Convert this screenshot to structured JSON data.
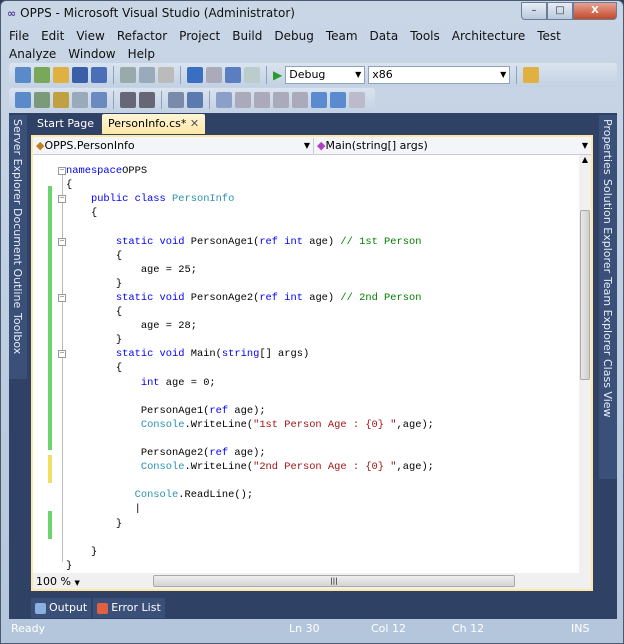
{
  "window": {
    "title": "OPPS - Microsoft Visual Studio (Administrator)",
    "minimize": "–",
    "maximize": "□",
    "close": "X"
  },
  "menu": [
    "File",
    "Edit",
    "View",
    "Refactor",
    "Project",
    "Build",
    "Debug",
    "Team",
    "Data",
    "Tools",
    "Architecture",
    "Test",
    "Analyze",
    "Window",
    "Help"
  ],
  "toolbar": {
    "config": "Debug",
    "platform": "x86"
  },
  "left_panels": [
    "Server Explorer",
    "Document Outline",
    "Toolbox"
  ],
  "right_panels": [
    "Properties",
    "Solution Explorer",
    "Team Explorer",
    "Class View"
  ],
  "tabs": [
    {
      "label": "Start Page"
    },
    {
      "label": "PersonInfo.cs*",
      "close": "✕"
    }
  ],
  "nav": {
    "type": "OPPS.PersonInfo",
    "member": "Main(string[] args)"
  },
  "code": [
    [
      [
        "kw",
        "namespace"
      ],
      [
        "",
        "OPPS"
      ]
    ],
    [
      [
        "",
        "{"
      ]
    ],
    [
      [
        "",
        "    "
      ],
      [
        "kw",
        "public class "
      ],
      [
        "ty",
        "PersonInfo"
      ]
    ],
    [
      [
        "",
        "    {"
      ]
    ],
    [],
    [
      [
        "",
        "        "
      ],
      [
        "kw",
        "static void "
      ],
      [
        "",
        "PersonAge1("
      ],
      [
        "kw",
        "ref int "
      ],
      [
        "",
        "age) "
      ],
      [
        "cm",
        "// 1st Person"
      ]
    ],
    [
      [
        "",
        "        {"
      ]
    ],
    [
      [
        "",
        "            age = 25;"
      ]
    ],
    [
      [
        "",
        "        }"
      ]
    ],
    [
      [
        "",
        "        "
      ],
      [
        "kw",
        "static void "
      ],
      [
        "",
        "PersonAge2("
      ],
      [
        "kw",
        "ref int "
      ],
      [
        "",
        "age) "
      ],
      [
        "cm",
        "// 2nd Person"
      ]
    ],
    [
      [
        "",
        "        {"
      ]
    ],
    [
      [
        "",
        "            age = 28;"
      ]
    ],
    [
      [
        "",
        "        }"
      ]
    ],
    [
      [
        "",
        "        "
      ],
      [
        "kw",
        "static void "
      ],
      [
        "",
        "Main("
      ],
      [
        "kw",
        "string"
      ],
      [
        "",
        "[] args)"
      ]
    ],
    [
      [
        "",
        "        {"
      ]
    ],
    [
      [
        "",
        "            "
      ],
      [
        "kw",
        "int "
      ],
      [
        "",
        "age = 0;"
      ]
    ],
    [],
    [
      [
        "",
        "            PersonAge1("
      ],
      [
        "kw",
        "ref "
      ],
      [
        "",
        "age);"
      ]
    ],
    [
      [
        "",
        "            "
      ],
      [
        "ty",
        "Console"
      ],
      [
        "",
        ".WriteLine("
      ],
      [
        "st",
        "\"1st Person Age : {0} \""
      ],
      [
        "",
        ",age);"
      ]
    ],
    [],
    [
      [
        "",
        "            PersonAge2("
      ],
      [
        "kw",
        "ref "
      ],
      [
        "",
        "age);"
      ]
    ],
    [
      [
        "",
        "            "
      ],
      [
        "ty",
        "Console"
      ],
      [
        "",
        ".WriteLine("
      ],
      [
        "st",
        "\"2nd Person Age : {0} \""
      ],
      [
        "",
        ",age);"
      ]
    ],
    [],
    [
      [
        "",
        "           "
      ],
      [
        "ty",
        "Console"
      ],
      [
        "",
        ".ReadLine();"
      ]
    ],
    [
      [
        "",
        "           |"
      ]
    ],
    [
      [
        "",
        "        }"
      ]
    ],
    [],
    [
      [
        "",
        "    }"
      ]
    ],
    [
      [
        "",
        "}"
      ]
    ]
  ],
  "zoom": "100 %",
  "bottom_tabs": [
    "Output",
    "Error List"
  ],
  "status": {
    "ready": "Ready",
    "ln": "Ln 30",
    "col": "Col 12",
    "ch": "Ch 12",
    "ins": "INS"
  }
}
